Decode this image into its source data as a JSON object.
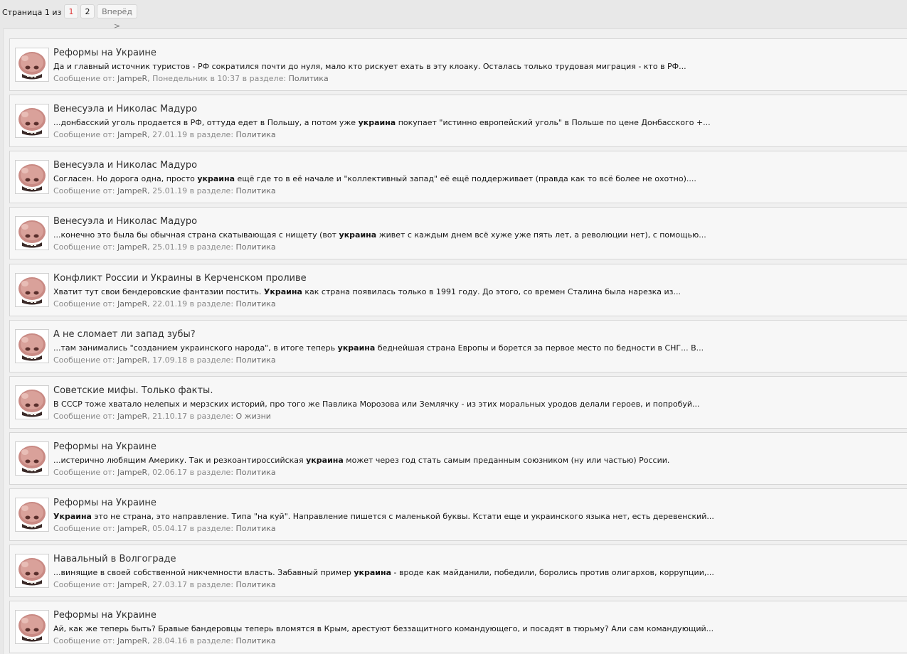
{
  "pagination": {
    "label": "Страница 1 из 2",
    "pages": [
      "1",
      "2"
    ],
    "current": "1",
    "next_label": "Вперёд >"
  },
  "results": [
    {
      "title": "Реформы на Украине",
      "snippet_before": "Да и главный источник туристов - РФ сократился почти до нуля, мало кто рискует ехать в эту клоаку. Осталась только трудовая миграция - кто в РФ...",
      "snippet_hl": "",
      "snippet_after": "",
      "meta_prefix": "Сообщение от:",
      "author": "JampeR",
      "date": "Понедельник в 10:37",
      "section_prefix": "в разделе:",
      "forum": "Политика"
    },
    {
      "title": "Венесуэла и Николас Мадуро",
      "snippet_before": "...донбасский уголь продается в РФ, оттуда едет в Польшу, а потом уже ",
      "snippet_hl": "украина",
      "snippet_after": " покупает \"истинно европейский уголь\" в Польше по цене Донбасского +...",
      "meta_prefix": "Сообщение от:",
      "author": "JampeR",
      "date": "27.01.19",
      "section_prefix": "в разделе:",
      "forum": "Политика"
    },
    {
      "title": "Венесуэла и Николас Мадуро",
      "snippet_before": "Согласен. Но дорога одна, просто ",
      "snippet_hl": "украина",
      "snippet_after": " ещё где то в её начале и \"коллективный запад\" её ещё поддерживает (правда как то всё более не охотно)....",
      "meta_prefix": "Сообщение от:",
      "author": "JampeR",
      "date": "25.01.19",
      "section_prefix": "в разделе:",
      "forum": "Политика"
    },
    {
      "title": "Венесуэла и Николас Мадуро",
      "snippet_before": "...конечно это была бы обычная страна скатывающая с нищету (вот ",
      "snippet_hl": "украина",
      "snippet_after": " живет с каждым днем всё хуже уже пять лет, а революции нет), с помощью...",
      "meta_prefix": "Сообщение от:",
      "author": "JampeR",
      "date": "25.01.19",
      "section_prefix": "в разделе:",
      "forum": "Политика"
    },
    {
      "title": "Конфликт России и Украины в Керченском проливе",
      "snippet_before": "Хватит тут свои бендеровские фантазии постить. ",
      "snippet_hl": "Украина",
      "snippet_after": " как страна появилась только в 1991 году. До этого, со времен Сталина была нарезка из...",
      "meta_prefix": "Сообщение от:",
      "author": "JampeR",
      "date": "22.01.19",
      "section_prefix": "в разделе:",
      "forum": "Политика"
    },
    {
      "title": "А не сломает ли запад зубы?",
      "snippet_before": "...там занимались \"созданием украинского народа\", в итоге теперь ",
      "snippet_hl": "украина",
      "snippet_after": " беднейшая страна Европы и борется за первое место по бедности в СНГ... В...",
      "meta_prefix": "Сообщение от:",
      "author": "JampeR",
      "date": "17.09.18",
      "section_prefix": "в разделе:",
      "forum": "Политика"
    },
    {
      "title": "Советские мифы. Только факты.",
      "snippet_before": "В СССР тоже хватало нелепых и мерзских историй, про того же Павлика Морозова или Землячку - из этих моральных уродов делали героев, и попробуй...",
      "snippet_hl": "",
      "snippet_after": "",
      "meta_prefix": "Сообщение от:",
      "author": "JampeR",
      "date": "21.10.17",
      "section_prefix": "в разделе:",
      "forum": "О жизни"
    },
    {
      "title": "Реформы на Украине",
      "snippet_before": "...истерично любящим Америку. Так и резкоантироссийская ",
      "snippet_hl": "украина",
      "snippet_after": " может через год стать самым преданным союзником (ну или частью) России.",
      "meta_prefix": "Сообщение от:",
      "author": "JampeR",
      "date": "02.06.17",
      "section_prefix": "в разделе:",
      "forum": "Политика"
    },
    {
      "title": "Реформы на Украине",
      "snippet_before": "",
      "snippet_hl": "Украина",
      "snippet_after": " это не страна, это направление. Типа \"на куй\". Направление пишется с маленькой буквы. Кстати еще и украинского языка нет, есть деревенский...",
      "meta_prefix": "Сообщение от:",
      "author": "JampeR",
      "date": "05.04.17",
      "section_prefix": "в разделе:",
      "forum": "Политика"
    },
    {
      "title": "Навальный в Волгограде",
      "snippet_before": "...винящие в своей собственной никчемности власть. Забавный пример ",
      "snippet_hl": "украина",
      "snippet_after": " - вроде как майданили, победили, боролись против олигархов, коррупции,...",
      "meta_prefix": "Сообщение от:",
      "author": "JampeR",
      "date": "27.03.17",
      "section_prefix": "в разделе:",
      "forum": "Политика"
    },
    {
      "title": "Реформы на Украине",
      "snippet_before": "Ай, как же теперь быть? Бравые бандеровцы теперь вломятся в Крым, арестуют беззащитного командующего, и посадят в тюрьму? Али сам командующий...",
      "snippet_hl": "",
      "snippet_after": "",
      "meta_prefix": "Сообщение от:",
      "author": "JampeR",
      "date": "28.04.16",
      "section_prefix": "в разделе:",
      "forum": "Политика"
    }
  ]
}
